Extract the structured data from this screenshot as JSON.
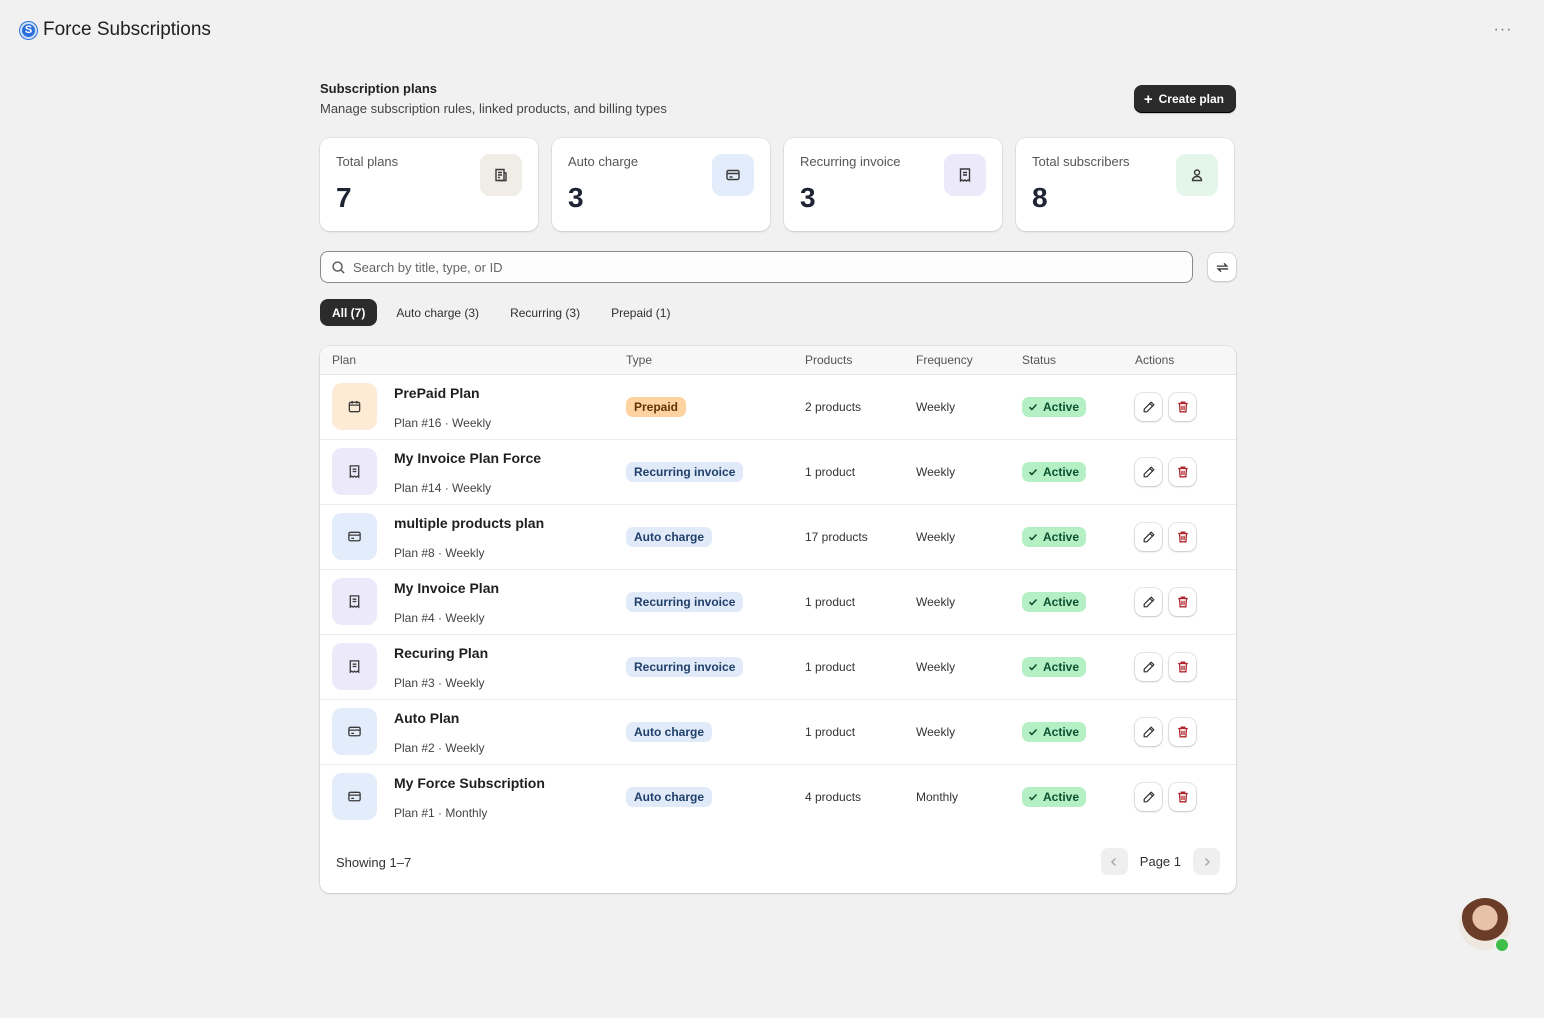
{
  "app": {
    "title": "Force Subscriptions",
    "logo_letter": "S",
    "more_label": "···"
  },
  "header": {
    "title": "Subscription plans",
    "subtitle": "Manage subscription rules, linked products, and billing types",
    "create_label": "Create plan"
  },
  "stats": [
    {
      "label": "Total plans",
      "value": "7",
      "icon": "plans-icon",
      "icon_bg": "#f0ede6"
    },
    {
      "label": "Auto charge",
      "value": "3",
      "icon": "credit-card-icon",
      "icon_bg": "#e2ecfb"
    },
    {
      "label": "Recurring invoice",
      "value": "3",
      "icon": "receipt-icon",
      "icon_bg": "#ece9fb"
    },
    {
      "label": "Total subscribers",
      "value": "8",
      "icon": "user-icon",
      "icon_bg": "#e3f6e9"
    }
  ],
  "search": {
    "placeholder": "Search by title, type, or ID",
    "value": ""
  },
  "tabs": [
    {
      "label": "All (7)",
      "active": true
    },
    {
      "label": "Auto charge (3)",
      "active": false
    },
    {
      "label": "Recurring (3)",
      "active": false
    },
    {
      "label": "Prepaid (1)",
      "active": false
    }
  ],
  "table": {
    "columns": [
      "Plan",
      "Type",
      "Products",
      "Frequency",
      "Status",
      "Actions"
    ],
    "rows": [
      {
        "name": "PrePaid Plan",
        "meta": "Plan #16 · Weekly",
        "type": "Prepaid",
        "kind": "prepaid",
        "products": "2 products",
        "frequency": "Weekly",
        "status": "Active"
      },
      {
        "name": "My Invoice Plan Force",
        "meta": "Plan #14 · Weekly",
        "type": "Recurring invoice",
        "kind": "invoice",
        "products": "1 product",
        "frequency": "Weekly",
        "status": "Active"
      },
      {
        "name": "multiple products plan",
        "meta": "Plan #8 · Weekly",
        "type": "Auto charge",
        "kind": "auto",
        "products": "17 products",
        "frequency": "Weekly",
        "status": "Active"
      },
      {
        "name": "My Invoice Plan",
        "meta": "Plan #4 · Weekly",
        "type": "Recurring invoice",
        "kind": "invoice",
        "products": "1 product",
        "frequency": "Weekly",
        "status": "Active"
      },
      {
        "name": "Recuring Plan",
        "meta": "Plan #3 · Weekly",
        "type": "Recurring invoice",
        "kind": "invoice",
        "products": "1 product",
        "frequency": "Weekly",
        "status": "Active"
      },
      {
        "name": "Auto Plan",
        "meta": "Plan #2 · Weekly",
        "type": "Auto charge",
        "kind": "auto",
        "products": "1 product",
        "frequency": "Weekly",
        "status": "Active"
      },
      {
        "name": "My Force Subscription",
        "meta": "Plan #1 · Monthly",
        "type": "Auto charge",
        "kind": "auto",
        "products": "4 products",
        "frequency": "Monthly",
        "status": "Active"
      }
    ],
    "showing": "Showing 1–7",
    "page_label": "Page 1"
  },
  "theme": {
    "prepaid": {
      "icon_bg": "#fdebd6",
      "badge_bg": "#fed3a0",
      "badge_fg": "#5e3700"
    },
    "invoice": {
      "icon_bg": "#ece9fb",
      "badge_bg": "#e0eaf8",
      "badge_fg": "#20406b"
    },
    "auto": {
      "icon_bg": "#e2ecfb",
      "badge_bg": "#e0eaf8",
      "badge_fg": "#20406b"
    },
    "status_bg": "#b4f0c4",
    "delete_color": "#b0232a",
    "primary": "#2b2b2b"
  }
}
